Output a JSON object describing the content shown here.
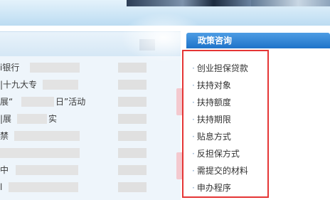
{
  "left_panel": {
    "news_items": [
      {
        "title": "i银行"
      },
      {
        "title": "|十九大专"
      },
      {
        "title": "展“",
        "title_tail": "日”活动"
      },
      {
        "title": "|展",
        "title_tail": "实"
      },
      {
        "title": "禁"
      },
      {
        "title": ""
      },
      {
        "title": "中"
      },
      {
        "title": "l"
      }
    ]
  },
  "policy": {
    "title": "政策咨询",
    "items": [
      "创业担保贷款",
      "扶持对象",
      "扶持额度",
      "扶持期限",
      "贴息方式",
      "反担保方式",
      "需提交的材料",
      "申办程序"
    ],
    "bullet": "·"
  },
  "colors": {
    "header_blue": "#1f73c9",
    "highlight_red": "#e53535"
  }
}
